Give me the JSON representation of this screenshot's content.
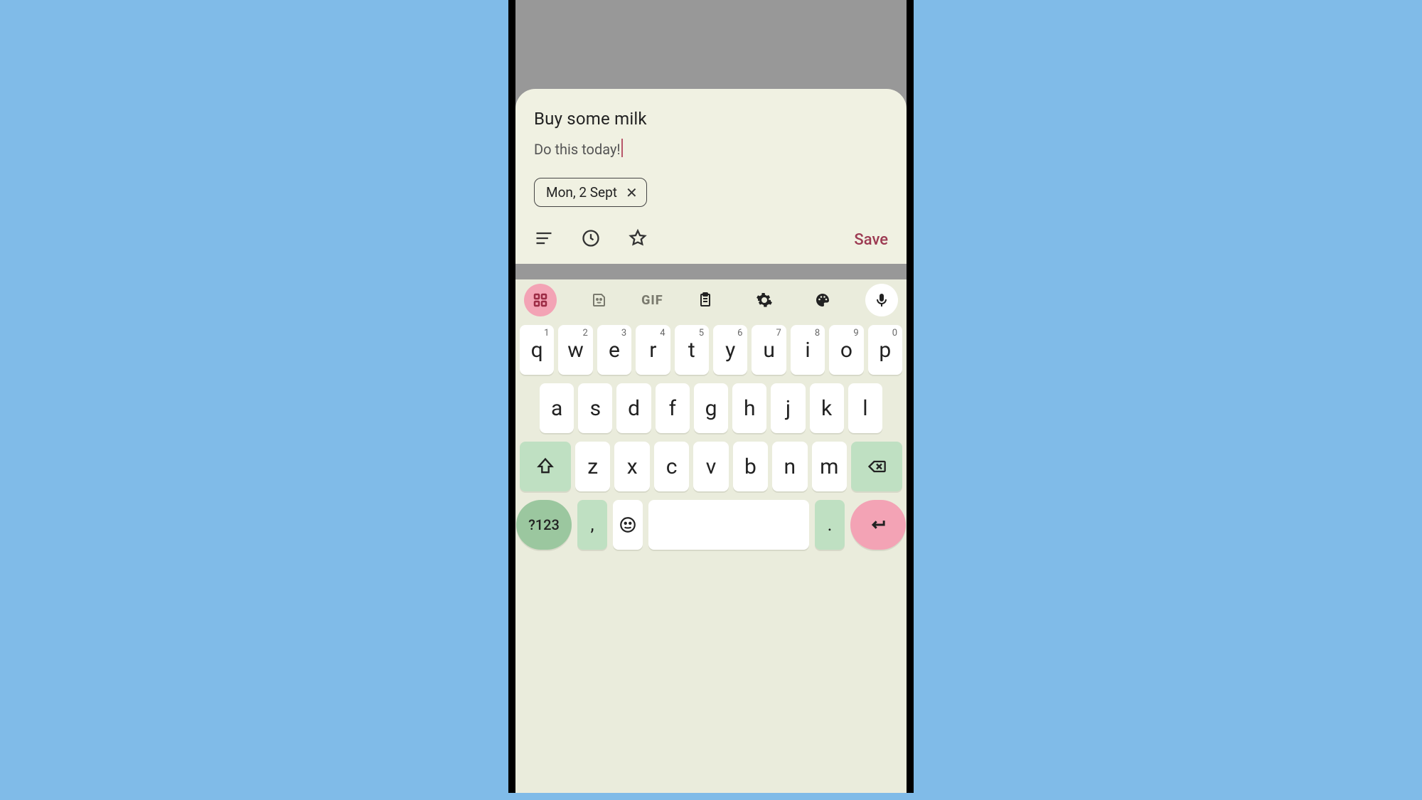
{
  "task": {
    "title": "Buy some milk",
    "note": "Do this today!"
  },
  "chip": {
    "label": "Mon, 2 Sept",
    "close": "✕"
  },
  "toolbar": {
    "save_label": "Save"
  },
  "suggest": {
    "gif_label": "GIF"
  },
  "keyboard": {
    "row1": [
      {
        "k": "q",
        "s": "1"
      },
      {
        "k": "w",
        "s": "2"
      },
      {
        "k": "e",
        "s": "3"
      },
      {
        "k": "r",
        "s": "4"
      },
      {
        "k": "t",
        "s": "5"
      },
      {
        "k": "y",
        "s": "6"
      },
      {
        "k": "u",
        "s": "7"
      },
      {
        "k": "i",
        "s": "8"
      },
      {
        "k": "o",
        "s": "9"
      },
      {
        "k": "p",
        "s": "0"
      }
    ],
    "row2": [
      "a",
      "s",
      "d",
      "f",
      "g",
      "h",
      "j",
      "k",
      "l"
    ],
    "row3": [
      "z",
      "x",
      "c",
      "v",
      "b",
      "n",
      "m"
    ],
    "sym_label": "?123",
    "comma": ",",
    "period": "."
  }
}
